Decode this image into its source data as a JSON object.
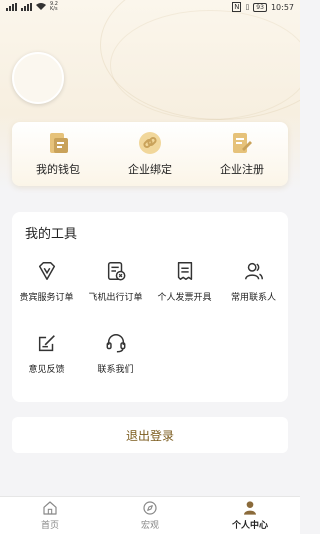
{
  "status": {
    "net_speed": "9.2\nK/s",
    "time": "10:57",
    "battery": "93"
  },
  "colors": {
    "gold": "#c9a25a",
    "gold_dark": "#7a5a1c",
    "active_tab": "#8a6a3a"
  },
  "shortcuts": [
    {
      "label": "我的钱包",
      "icon": "wallet-icon"
    },
    {
      "label": "企业绑定",
      "icon": "link-icon"
    },
    {
      "label": "企业注册",
      "icon": "register-icon"
    }
  ],
  "tools": {
    "title": "我的工具",
    "items": [
      {
        "label": "贵宾服务订单",
        "icon": "vip-icon"
      },
      {
        "label": "飞机出行订单",
        "icon": "flight-order-icon"
      },
      {
        "label": "个人发票开具",
        "icon": "invoice-icon"
      },
      {
        "label": "常用联系人",
        "icon": "contacts-icon"
      },
      {
        "label": "意见反馈",
        "icon": "feedback-icon"
      },
      {
        "label": "联系我们",
        "icon": "headset-icon"
      }
    ]
  },
  "logout_label": "退出登录",
  "tabs": [
    {
      "label": "首页",
      "icon": "home-icon",
      "active": false
    },
    {
      "label": "宏观",
      "icon": "compass-icon",
      "active": false
    },
    {
      "label": "个人中心",
      "icon": "user-icon",
      "active": true
    }
  ]
}
